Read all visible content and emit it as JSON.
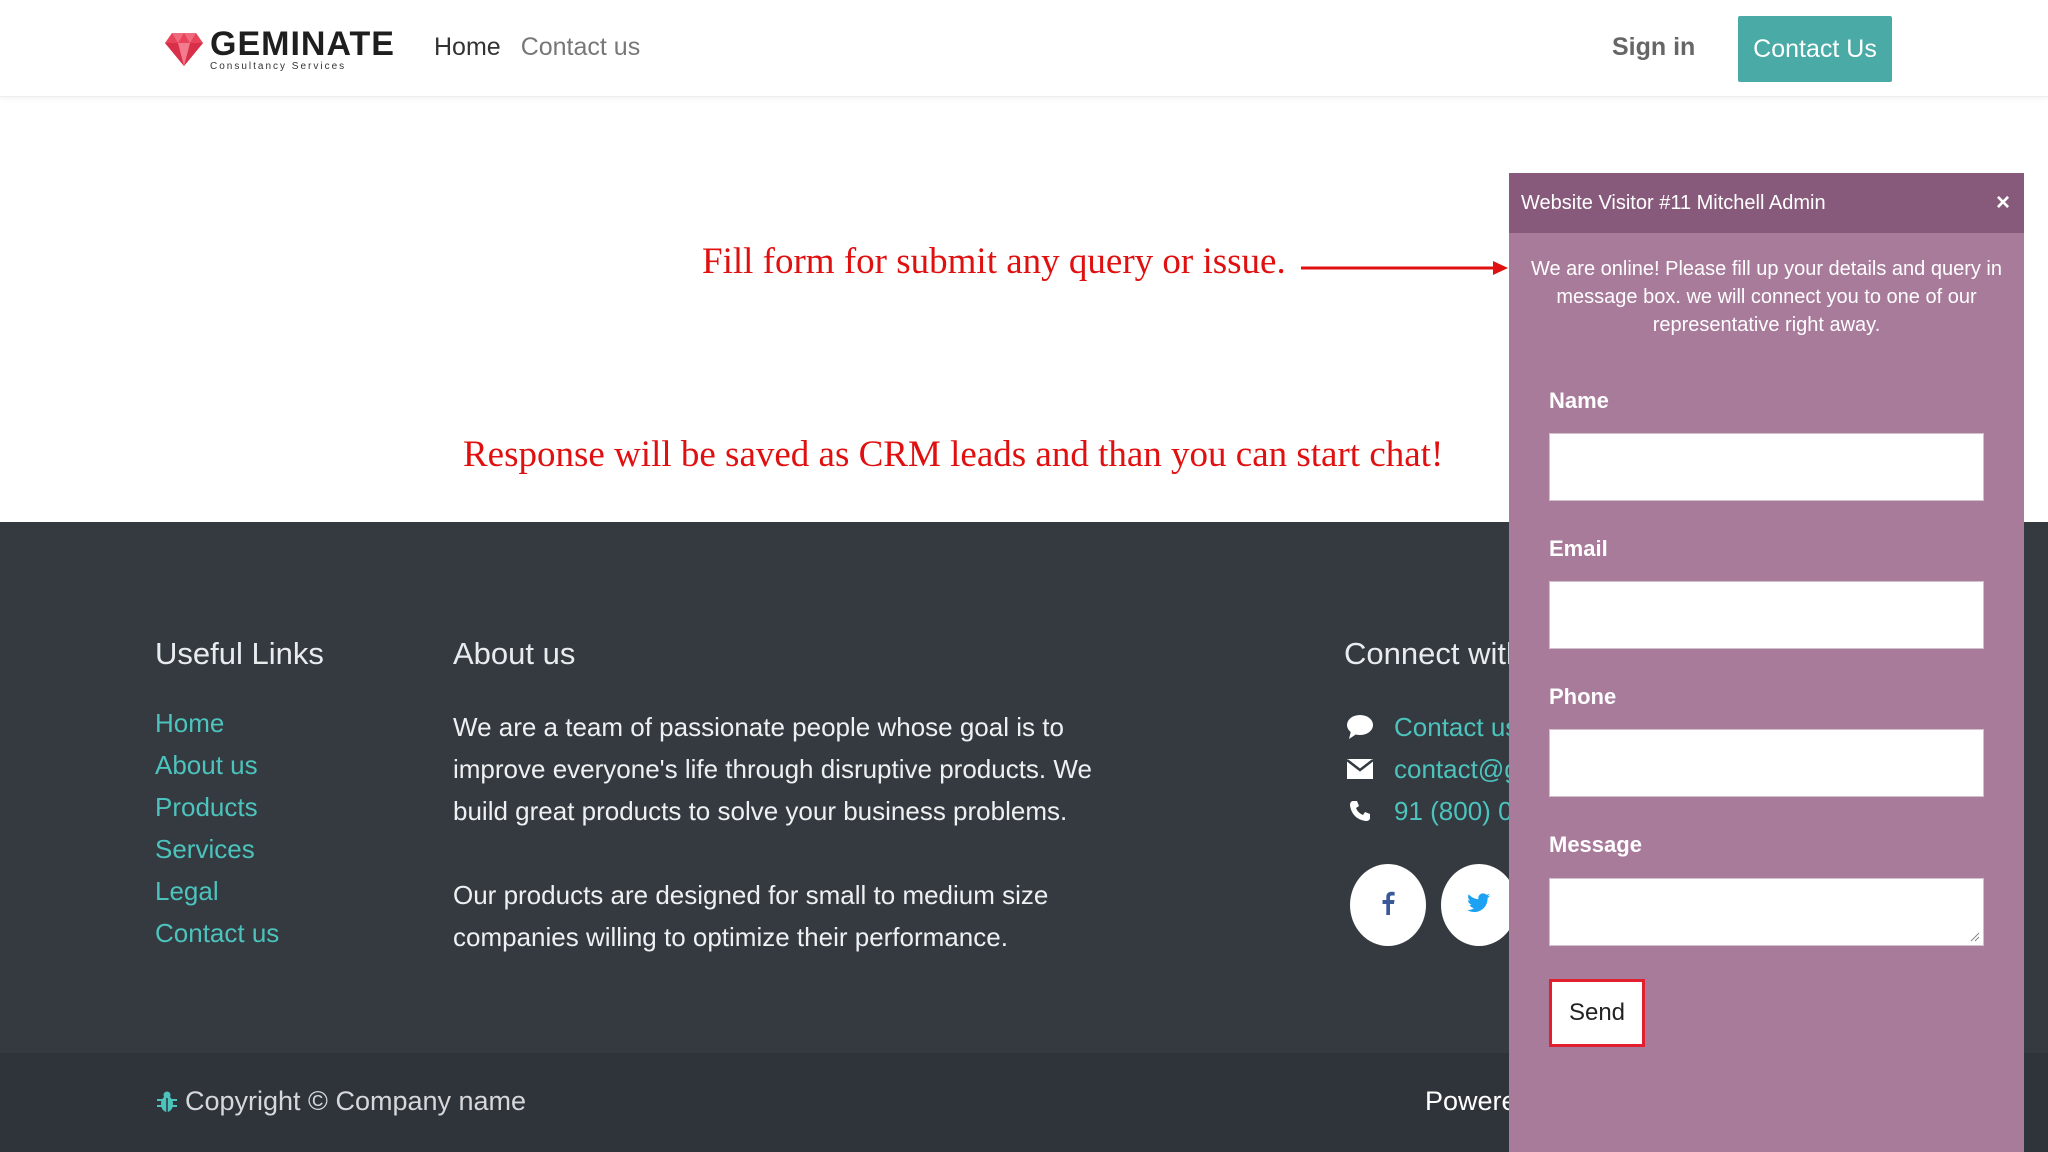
{
  "header": {
    "logo_text": "GEMINATE",
    "logo_subtext": "Consultancy Services",
    "nav": [
      {
        "label": "Home",
        "active": true
      },
      {
        "label": "Contact us",
        "active": false
      }
    ],
    "signin_label": "Sign in",
    "contact_button_label": "Contact Us"
  },
  "annotations": {
    "top": "Fill form for submit any query or issue.",
    "bottom": "Response will be saved as CRM leads and than you can start chat!",
    "color": "#e01010"
  },
  "footer": {
    "useful_links_title": "Useful Links",
    "useful_links": [
      "Home",
      "About us",
      "Products",
      "Services",
      "Legal",
      "Contact us"
    ],
    "about_title": "About us",
    "about_paragraphs": [
      "We are a team of passionate people whose goal is to improve everyone's life through disruptive products. We build great products to solve your business problems.",
      "Our products are designed for small to medium size companies willing to optimize their performance."
    ],
    "connect_title": "Connect with",
    "contacts": [
      {
        "icon": "comment-icon",
        "text": "Contact us"
      },
      {
        "icon": "envelope-icon",
        "text": "contact@g"
      },
      {
        "icon": "phone-icon",
        "text": "91 (800) 0"
      }
    ],
    "social": [
      {
        "icon": "facebook-icon"
      },
      {
        "icon": "twitter-icon"
      }
    ],
    "copyright": "Copyright © Company name",
    "powered": "Powere"
  },
  "chat": {
    "title": "Website Visitor #11 Mitchell Admin",
    "close_glyph": "×",
    "intro": "We are online! Please fill up your details and query in message box. we will connect you to one of our representative right away.",
    "fields": {
      "name_label": "Name",
      "email_label": "Email",
      "phone_label": "Phone",
      "message_label": "Message",
      "name_value": "",
      "email_value": "",
      "phone_value": "",
      "message_value": ""
    },
    "send_label": "Send"
  },
  "colors": {
    "accent": "#4aaaa5",
    "link": "#4cc3bd",
    "footer_bg": "#343a40",
    "chat_bg": "#a87b9b",
    "chat_header": "#875a7b"
  }
}
